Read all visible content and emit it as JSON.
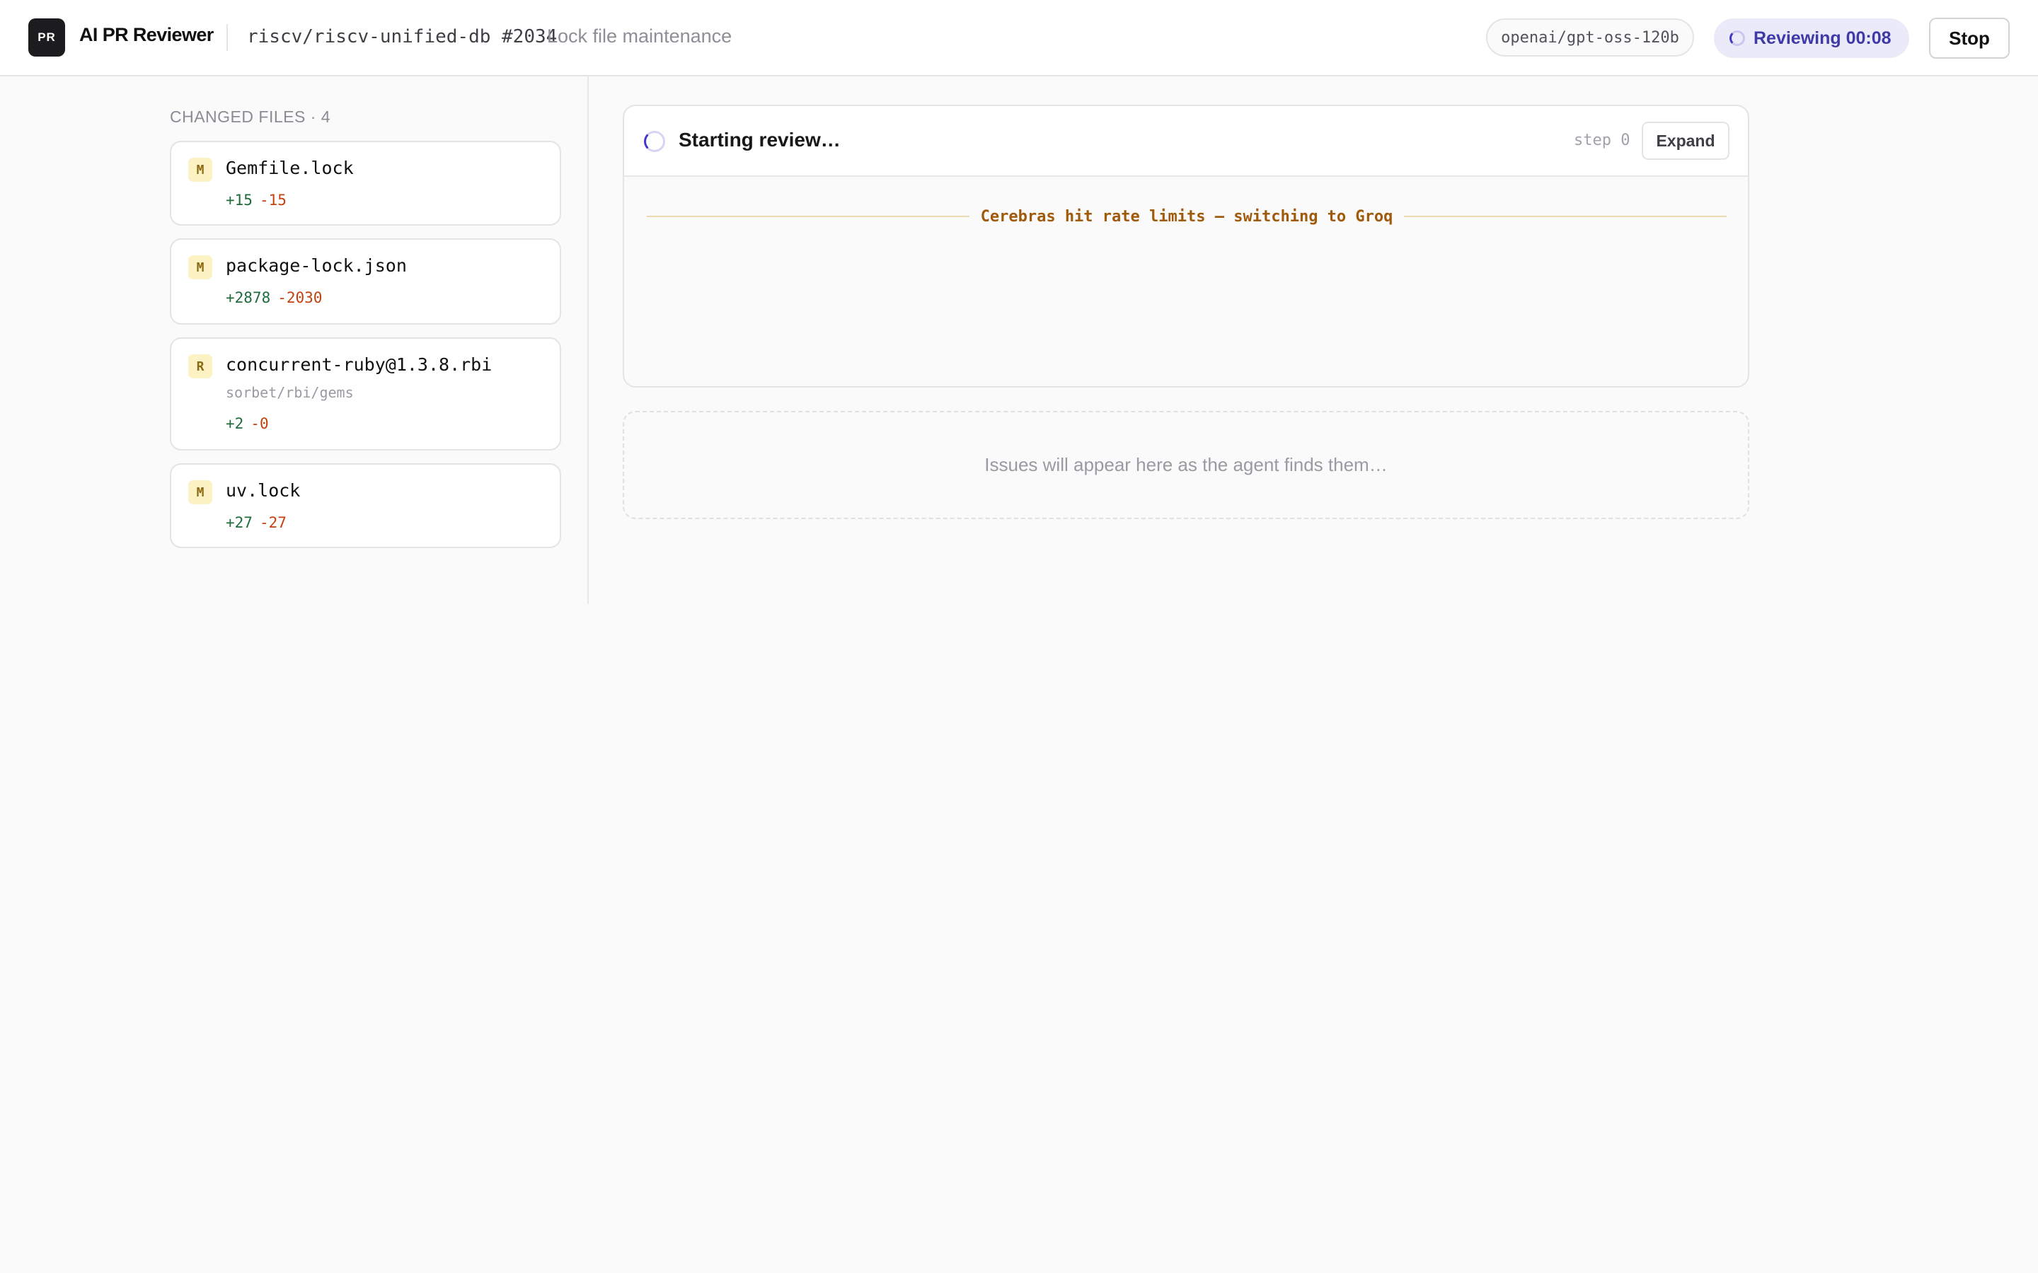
{
  "header": {
    "logo_text": "PR",
    "app_title": "AI PR Reviewer",
    "repo": "riscv/riscv-unified-db #2034",
    "pr_title": "Lock file maintenance",
    "model": "openai/gpt-oss-120b",
    "status": "Reviewing 00:08",
    "stop_label": "Stop"
  },
  "sidebar": {
    "heading": "CHANGED FILES · 4",
    "files": [
      {
        "status": "M",
        "name": "Gemfile.lock",
        "path": "",
        "additions": "+15",
        "deletions": "-15"
      },
      {
        "status": "M",
        "name": "package-lock.json",
        "path": "",
        "additions": "+2878",
        "deletions": "-2030"
      },
      {
        "status": "R",
        "name": "concurrent-ruby@1.3.8.rbi",
        "path": "sorbet/rbi/gems",
        "additions": "+2",
        "deletions": "-0"
      },
      {
        "status": "M",
        "name": "uv.lock",
        "path": "",
        "additions": "+27",
        "deletions": "-27"
      }
    ]
  },
  "review": {
    "status": "Starting review…",
    "step": "step 0",
    "expand_label": "Expand",
    "notice": "Cerebras hit rate limits — switching to Groq"
  },
  "issues": {
    "placeholder": "Issues will appear here as the agent finds them…"
  },
  "colors": {
    "accent": "#4338ca",
    "additions": "#1f6b3a",
    "deletions": "#c2410c",
    "notice": "#a05a0c",
    "badge_bg": "#fdf2c4"
  }
}
